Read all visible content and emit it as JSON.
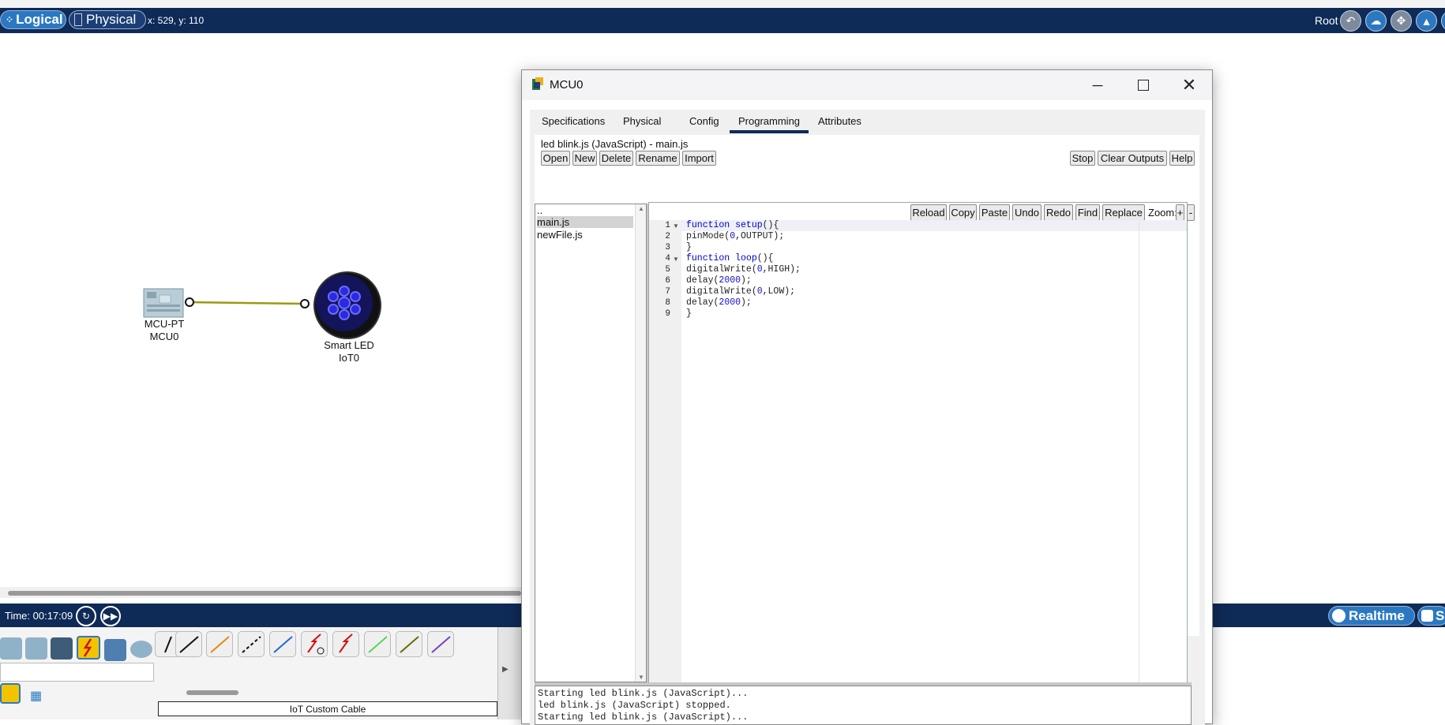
{
  "topbar": {
    "logical_label": "Logical",
    "physical_label": "Physical",
    "coords": "x: 529, y: 110",
    "root_label": "Root"
  },
  "workspace": {
    "devices": [
      {
        "model": "MCU-PT",
        "name": "MCU0"
      },
      {
        "model": "Smart LED",
        "name": "IoT0"
      }
    ]
  },
  "timebar": {
    "time": "Time: 00:17:09",
    "realtime_label": "Realtime",
    "simulation_label": "S"
  },
  "palette": {
    "cable_name": "IoT Custom Cable"
  },
  "dialog": {
    "title": "MCU0",
    "tabs": [
      "Specifications",
      "Physical",
      "Config",
      "Programming",
      "Attributes"
    ],
    "active_tab": "Programming",
    "project_title": "led blink.js (JavaScript) - main.js",
    "file_buttons": [
      "Open",
      "New",
      "Delete",
      "Rename",
      "Import"
    ],
    "run_buttons": [
      "Stop",
      "Clear Outputs",
      "Help"
    ],
    "file_list": [
      "..",
      "main.js",
      "newFile.js"
    ],
    "selected_file": "main.js",
    "editor_buttons": [
      "Reload",
      "Copy",
      "Paste",
      "Undo",
      "Redo",
      "Find",
      "Replace"
    ],
    "zoom_label": "Zoom:",
    "zoom_in": "+",
    "zoom_out": "-",
    "code_lines": [
      "function setup(){",
      "pinMode(0,OUTPUT);",
      "}",
      "function loop(){",
      "digitalWrite(0,HIGH);",
      "delay(2000);",
      "digitalWrite(0,LOW);",
      "delay(2000);",
      "}"
    ],
    "line_numbers": [
      "1",
      "2",
      "3",
      "4",
      "5",
      "6",
      "7",
      "8",
      "9"
    ],
    "output_lines": [
      "Starting led blink.js (JavaScript)...",
      "led blink.js (JavaScript) stopped.",
      "Starting led blink.js (JavaScript)..."
    ]
  },
  "colors": {
    "topbar_bg": "#0e2a57",
    "accent": "#2b78c2",
    "link_line": "#9a9a10"
  }
}
